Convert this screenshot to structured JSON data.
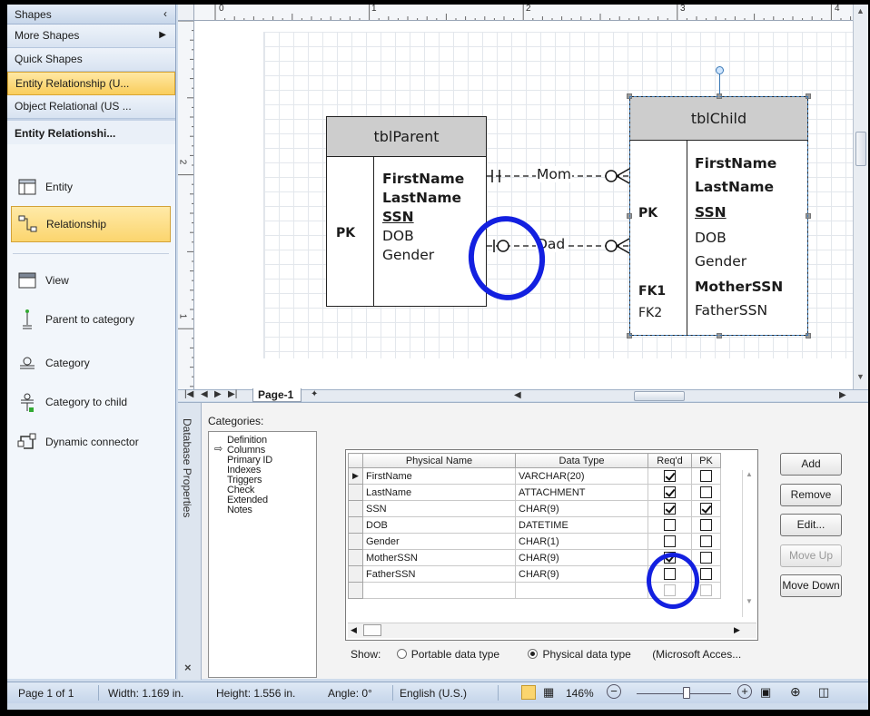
{
  "shapes_pane": {
    "title": "Shapes",
    "more_shapes": "More Shapes",
    "quick_shapes": "Quick Shapes",
    "stencils": [
      "Entity Relationship (U...",
      "Object Relational (US ..."
    ],
    "active_stencil_title": "Entity Relationshi...",
    "items": [
      {
        "label": "Entity",
        "icon": "entity-icon"
      },
      {
        "label": "Relationship",
        "icon": "relationship-icon"
      },
      {
        "label": "View",
        "icon": "view-icon"
      },
      {
        "label": "Parent to category",
        "icon": "parent-to-category-icon"
      },
      {
        "label": "Category",
        "icon": "category-icon"
      },
      {
        "label": "Category to child",
        "icon": "category-to-child-icon"
      },
      {
        "label": "Dynamic connector",
        "icon": "dynamic-connector-icon"
      }
    ]
  },
  "rulers": {
    "top_numbers": [
      "0",
      "1",
      "2",
      "3",
      "4"
    ],
    "left_numbers": [
      "2",
      "1"
    ]
  },
  "diagram": {
    "parent": {
      "title": "tblParent",
      "key": "PK",
      "columns": [
        "FirstName",
        "LastName",
        "SSN",
        "DOB",
        "Gender"
      ]
    },
    "child": {
      "title": "tblChild",
      "keys": [
        "PK",
        "FK1",
        "FK2"
      ],
      "columns": [
        "FirstName",
        "LastName",
        "SSN",
        "DOB",
        "Gender",
        "MotherSSN",
        "FatherSSN"
      ]
    },
    "relations": [
      "Mom",
      "Dad"
    ]
  },
  "page_tabs": {
    "current": "Page-1"
  },
  "db_properties": {
    "side_title": "Database Properties",
    "categories_label": "Categories:",
    "categories": [
      "Definition",
      "Columns",
      "Primary ID",
      "Indexes",
      "Triggers",
      "Check",
      "Extended",
      "Notes"
    ],
    "selected_category": "Columns",
    "columns_header": [
      "Physical Name",
      "Data Type",
      "Req'd",
      "PK"
    ],
    "rows": [
      {
        "name": "FirstName",
        "type": "VARCHAR(20)",
        "reqd": true,
        "pk": false
      },
      {
        "name": "LastName",
        "type": "ATTACHMENT",
        "reqd": true,
        "pk": false
      },
      {
        "name": "SSN",
        "type": "CHAR(9)",
        "reqd": true,
        "pk": true
      },
      {
        "name": "DOB",
        "type": "DATETIME",
        "reqd": false,
        "pk": false
      },
      {
        "name": "Gender",
        "type": "CHAR(1)",
        "reqd": false,
        "pk": false
      },
      {
        "name": "MotherSSN",
        "type": "CHAR(9)",
        "reqd": true,
        "pk": false
      },
      {
        "name": "FatherSSN",
        "type": "CHAR(9)",
        "reqd": false,
        "pk": false
      }
    ],
    "buttons": {
      "add": "Add",
      "remove": "Remove",
      "edit": "Edit...",
      "move_up": "Move Up",
      "move_down": "Move Down"
    },
    "show_label": "Show:",
    "portable": "Portable data type",
    "physical": "Physical data type",
    "driver": "(Microsoft Acces..."
  },
  "status": {
    "page": "Page 1 of 1",
    "width": "Width: 1.169 in.",
    "height": "Height: 1.556 in.",
    "angle": "Angle: 0°",
    "language": "English (U.S.)",
    "zoom": "146%"
  },
  "colors": {
    "annotation": "#1320e0",
    "selection": "#fbd56e",
    "entity_header": "#cdcdcd"
  }
}
